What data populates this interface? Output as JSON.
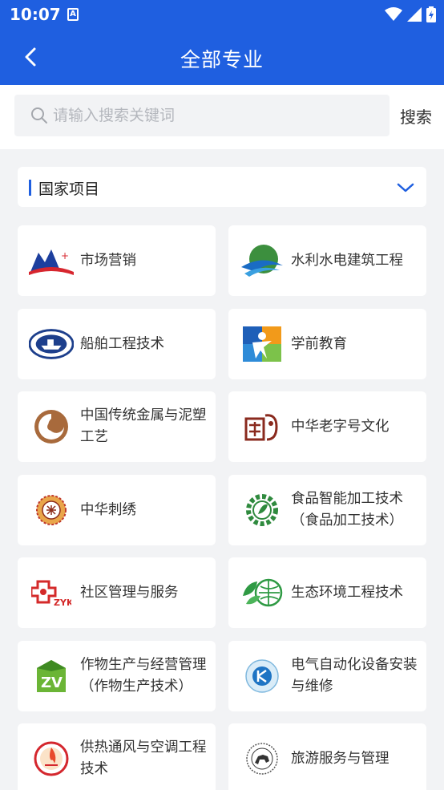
{
  "status_bar": {
    "time": "10:07",
    "notification_letter": "A"
  },
  "header": {
    "title": "全部专业"
  },
  "search": {
    "placeholder": "请输入搜索关键词",
    "button_label": "搜索",
    "value": ""
  },
  "category": {
    "label": "国家项目"
  },
  "majors": [
    {
      "name": "市场营销",
      "logo": "market-logo-icon"
    },
    {
      "name": "水利水电建筑工程",
      "logo": "hydro-logo-icon"
    },
    {
      "name": "船舶工程技术",
      "logo": "ship-logo-icon"
    },
    {
      "name": "学前教育",
      "logo": "preschool-logo-icon"
    },
    {
      "name": "中国传统金属与泥塑工艺",
      "logo": "metal-clay-logo-icon"
    },
    {
      "name": "中华老字号文化",
      "logo": "old-brand-logo-icon"
    },
    {
      "name": "中华刺绣",
      "logo": "embroidery-logo-icon"
    },
    {
      "name": "食品智能加工技术（食品加工技术）",
      "logo": "food-logo-icon"
    },
    {
      "name": "社区管理与服务",
      "logo": "community-logo-icon"
    },
    {
      "name": "生态环境工程技术",
      "logo": "ecology-logo-icon"
    },
    {
      "name": "作物生产与经营管理（作物生产技术）",
      "logo": "crop-logo-icon"
    },
    {
      "name": "电气自动化设备安装与维修",
      "logo": "electric-logo-icon"
    },
    {
      "name": "供热通风与空调工程技术",
      "logo": "hvac-logo-icon"
    },
    {
      "name": "旅游服务与管理",
      "logo": "tourism-logo-icon"
    }
  ],
  "colors": {
    "primary": "#1f5fe0",
    "background": "#f2f3f5"
  }
}
